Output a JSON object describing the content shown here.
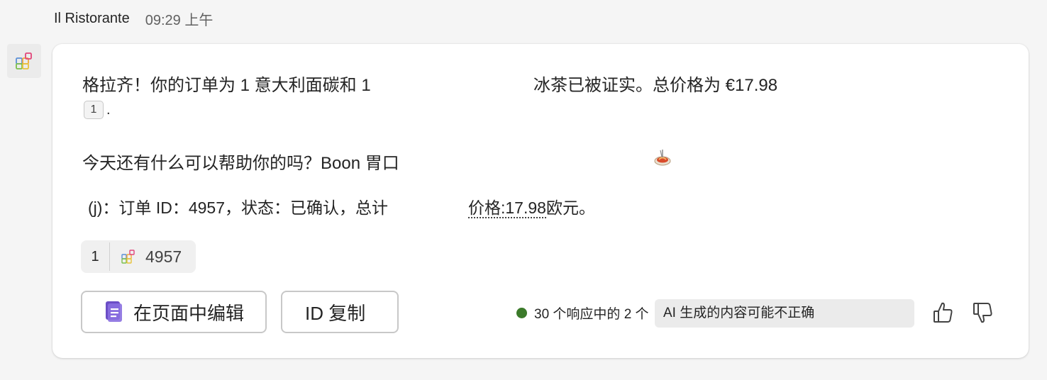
{
  "header": {
    "sender": "Il Ristorante",
    "time": "09:29 上午"
  },
  "message": {
    "line1": "格拉齐！你的订单为 1 意大利面碳和 1",
    "line1_cont": "冰茶已被证实。总价格为 €17.98",
    "citation_number": "1",
    "citation_trailing": ".",
    "line2": "今天还有什么可以帮助你的吗？Boon 胃口",
    "line3": "(j)：订单 ID：4957，状态：已确认，总计",
    "line3_cont_label": "价格:17.98",
    "line3_cont_rest": "欧元。",
    "emoji_icon": "spaghetti-emoji-icon"
  },
  "reference_chip": {
    "number": "1",
    "icon": "app-grid-icon",
    "id": "4957"
  },
  "actions": {
    "edit_label": "在页面中编辑",
    "edit_icon": "loop-page-icon",
    "copy_label": "ID 复制"
  },
  "footer": {
    "status_text": "30 个响应中的 2 个",
    "status_color": "#3b7a2a",
    "ai_disclaimer": "AI 生成的内容可能不正确",
    "like_icon": "thumbs-up-icon",
    "dislike_icon": "thumbs-down-icon"
  },
  "colors": {
    "background": "#f5f5f5",
    "card": "#ffffff",
    "accent_purple": "#6b4ec6"
  }
}
